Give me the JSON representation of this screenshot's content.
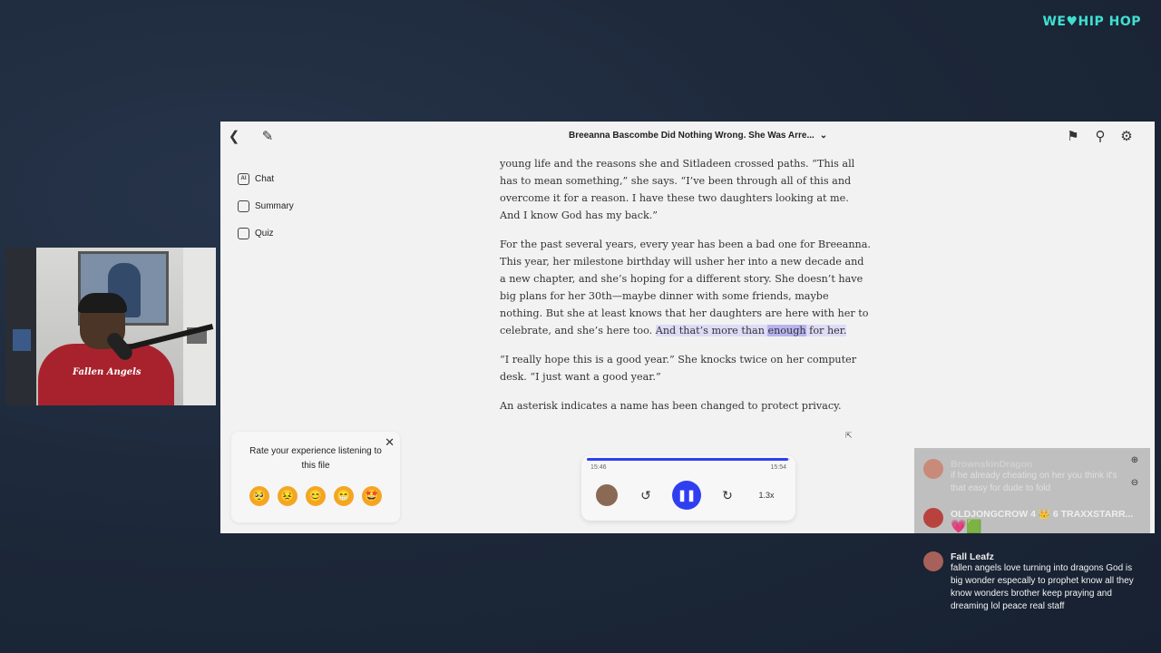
{
  "brand": {
    "logo_text_a": "WE",
    "logo_text_b": "HIP HOP",
    "heart": "♥"
  },
  "webcam": {
    "shirt_text": "Fallen Angels"
  },
  "app": {
    "title": "Breeanna Bascombe Did Nothing Wrong. She Was Arre...",
    "sidenav": [
      {
        "label": "Chat",
        "icon": "ai-chat-icon"
      },
      {
        "label": "Summary",
        "icon": "summary-icon"
      },
      {
        "label": "Quiz",
        "icon": "quiz-icon"
      }
    ],
    "article": {
      "p1": "young life and the reasons she and Sitladeen crossed paths. “This all has to mean something,” she says. “I’ve been through all of this and overcome it for a reason. I have these two daughters looking at me. And I know God has my back.”",
      "p2_plain": "For the past several years, every year has been a bad one for Breeanna. This year, her milestone birthday will usher her into a new decade and a new chapter, and she’s hoping for a different story. She doesn’t have big plans for her 30th—maybe dinner with some friends, maybe nothing. But she at least knows that her daughters are here with her to celebrate, and she’s here too.",
      "p2_hl_a": "And that’s more than ",
      "p2_hl_word": "enough",
      "p2_hl_b": " for her.",
      "p3": "“I really hope this is a good year.” She knocks twice on her computer desk. “I just want a good year.”",
      "p4": "An asterisk indicates a name has been changed to protect privacy."
    },
    "rating": {
      "title": "Rate your experience listening to this file",
      "emojis": [
        "🥺",
        "😣",
        "😊",
        "😁",
        "🤩"
      ]
    },
    "player": {
      "elapsed": "15:46",
      "total": "15:54",
      "progress": 0.99,
      "speed": "1.3x",
      "back_icon": "↺",
      "forward_icon": "↻",
      "pause_icon": "❚❚",
      "accent": "#2f3ff0"
    }
  },
  "chat": {
    "messages": [
      {
        "name": "BrownskinDragon",
        "text": "if he already cheating on her you think it's that easy for dude to fold",
        "faded": true
      },
      {
        "name": "OLDJONGCROW 4 👑 6 TRAXXSTARR...",
        "text": "💗🟩",
        "faded": false
      },
      {
        "name": "Fall Leafz",
        "text": "fallen angels love turning into dragons God is big wonder especally to prophet know all they know wonders brother keep praying and dreaming lol peace real staff",
        "faded": false
      }
    ]
  }
}
